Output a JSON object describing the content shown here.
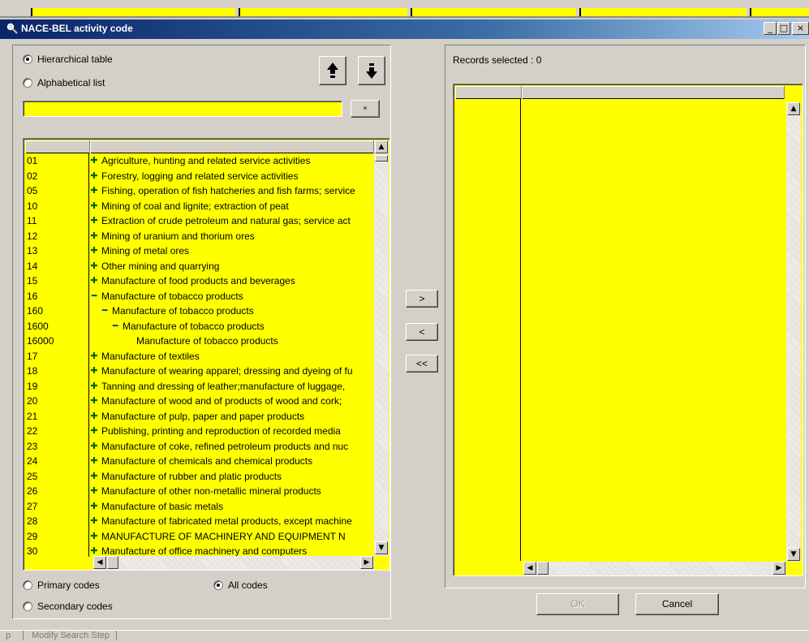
{
  "window": {
    "title": "NACE-BEL activity code",
    "minimize_glyph": "_",
    "maximize_glyph": "□",
    "close_glyph": "×"
  },
  "left": {
    "hierarchical_label": "Hierarchical table",
    "alphabetical_label": "Alphabetical list",
    "clear_label": "×",
    "search_value": "",
    "primary_label": "Primary codes",
    "secondary_label": "Secondary codes",
    "all_label": "All codes",
    "rows": [
      {
        "code": "01",
        "desc": "Agriculture, hunting and related service activities",
        "exp": "plus",
        "indent": 0
      },
      {
        "code": "02",
        "desc": "Forestry, logging and related service activities",
        "exp": "plus",
        "indent": 0
      },
      {
        "code": "05",
        "desc": "Fishing, operation of fish hatcheries and fish farms; service",
        "exp": "plus",
        "indent": 0
      },
      {
        "code": "10",
        "desc": "Mining of coal and lignite; extraction of peat",
        "exp": "plus",
        "indent": 0
      },
      {
        "code": "11",
        "desc": "Extraction of crude petroleum and natural gas; service act",
        "exp": "plus",
        "indent": 0
      },
      {
        "code": "12",
        "desc": "Mining of uranium and thorium ores",
        "exp": "plus",
        "indent": 0
      },
      {
        "code": "13",
        "desc": "Mining of metal ores",
        "exp": "plus",
        "indent": 0
      },
      {
        "code": "14",
        "desc": "Other mining and quarrying",
        "exp": "plus",
        "indent": 0
      },
      {
        "code": "15",
        "desc": "Manufacture of food products and beverages",
        "exp": "plus",
        "indent": 0
      },
      {
        "code": "16",
        "desc": "Manufacture of tobacco products",
        "exp": "minus",
        "indent": 0
      },
      {
        "code": "160",
        "desc": "Manufacture of tobacco products",
        "exp": "minus",
        "indent": 1
      },
      {
        "code": "1600",
        "desc": "Manufacture of tobacco products",
        "exp": "minus",
        "indent": 2
      },
      {
        "code": "16000",
        "desc": "Manufacture of tobacco products",
        "exp": "none",
        "indent": 3
      },
      {
        "code": "17",
        "desc": "Manufacture of textiles",
        "exp": "plus",
        "indent": 0
      },
      {
        "code": "18",
        "desc": "Manufacture of wearing apparel; dressing and dyeing of fu",
        "exp": "plus",
        "indent": 0
      },
      {
        "code": "19",
        "desc": "Tanning and dressing of leather;manufacture of luggage, ",
        "exp": "plus",
        "indent": 0
      },
      {
        "code": "20",
        "desc": "Manufacture of wood and of products of wood and cork; ",
        "exp": "plus",
        "indent": 0
      },
      {
        "code": "21",
        "desc": "Manufacture of pulp, paper and paper products",
        "exp": "plus",
        "indent": 0
      },
      {
        "code": "22",
        "desc": "Publishing, printing and reproduction of recorded media",
        "exp": "plus",
        "indent": 0
      },
      {
        "code": "23",
        "desc": "Manufacture of coke, refined petroleum products and nuc",
        "exp": "plus",
        "indent": 0
      },
      {
        "code": "24",
        "desc": "Manufacture of chemicals and chemical products",
        "exp": "plus",
        "indent": 0
      },
      {
        "code": "25",
        "desc": "Manufacture of rubber and platic products",
        "exp": "plus",
        "indent": 0
      },
      {
        "code": "26",
        "desc": "Manufacture of other non-metallic mineral products",
        "exp": "plus",
        "indent": 0
      },
      {
        "code": "27",
        "desc": "Manufacture of basic metals",
        "exp": "plus",
        "indent": 0
      },
      {
        "code": "28",
        "desc": "Manufacture of fabricated metal products, except machine",
        "exp": "plus",
        "indent": 0
      },
      {
        "code": "29",
        "desc": "MANUFACTURE OF MACHINERY AND EQUIPMENT N",
        "exp": "plus",
        "indent": 0
      },
      {
        "code": "30",
        "desc": "Manufacture of office machinery and computers",
        "exp": "plus",
        "indent": 0
      }
    ]
  },
  "middle": {
    "add_label": ">",
    "remove_label": "<",
    "remove_all_label": "<<"
  },
  "right": {
    "records_label": "Records selected : 0",
    "ok_label": "OK",
    "cancel_label": "Cancel"
  },
  "status": {
    "left_text": "p",
    "step_label": "Modify Search Step"
  },
  "colors": {
    "grid_bg": "#ffff00",
    "face": "#d4d0c8",
    "title_from": "#0a246a"
  }
}
